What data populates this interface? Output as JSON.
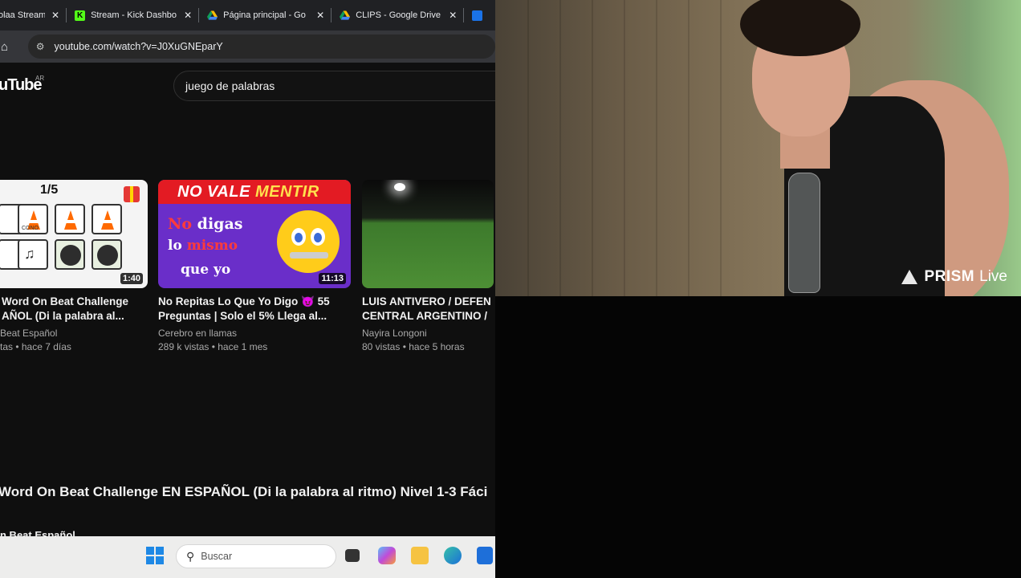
{
  "browser": {
    "tabs": [
      {
        "label": "olaa Stream",
        "favicon": "stream-favicon",
        "color": "#888888"
      },
      {
        "label": "Stream - Kick Dashbo",
        "favicon": "kick-favicon",
        "color": "#53fc18"
      },
      {
        "label": "Página principal - Go",
        "favicon": "drive-favicon",
        "color": "#fbbc04"
      },
      {
        "label": "CLIPS - Google Drive",
        "favicon": "drive-favicon",
        "color": "#fbbc04"
      }
    ],
    "close_glyph": "✕",
    "url": "youtube.com/watch?v=J0XuGNEparY"
  },
  "youtube": {
    "logo": "uTube",
    "country": "AR",
    "search_query": "juego de palabras",
    "videos": [
      {
        "title": "Word On Beat Challenge ... AÑOL (Di la palabra al...",
        "title_line1": "Word On Beat Challenge",
        "title_line2": "AÑOL (Di la palabra al...",
        "channel": "Beat Español",
        "meta": "tas • hace 7 días",
        "duration": "1:40",
        "thumb_counter": "1/5",
        "thumb_label": "CONO"
      },
      {
        "title_line1": "No Repitas Lo Que Yo Digo 😈 55",
        "title_line2": "Preguntas | Solo el 5% Llega al...",
        "channel": "Cerebro en llamas",
        "meta": "289 k vistas • hace 1 mes",
        "duration": "11:13",
        "thumb_banner_a": "NO VALE",
        "thumb_banner_b": "MENTIR",
        "thumb_line1_a": "No ",
        "thumb_line1_b": "digas",
        "thumb_line2_a": "lo ",
        "thumb_line2_b": "mismo",
        "thumb_line3": "que yo"
      },
      {
        "title_line1": "LUIS ANTIVERO / DEFEN",
        "title_line2": "CENTRAL ARGENTINO /",
        "channel": "Nayira Longoni",
        "meta": "80 vistas • hace 5 horas"
      }
    ],
    "current_title": "Word On Beat Challenge EN ESPAÑOL (Di la palabra al ritmo) Nivel 1-3 Fáci",
    "current_channel": "n Beat Español"
  },
  "taskbar": {
    "search_placeholder": "Buscar",
    "apps": [
      "file-explorer-icon",
      "edge-icon",
      "store-icon"
    ]
  },
  "overlay": {
    "brand": "PRISM",
    "brand_suffix": "Live"
  },
  "colors": {
    "youtube_bg": "#0f0f0f",
    "chrome_tabbar": "#202124",
    "taskbar": "#ededec",
    "thumb2_band": "#e31b23",
    "thumb2_bg": "#6a2ec9"
  }
}
